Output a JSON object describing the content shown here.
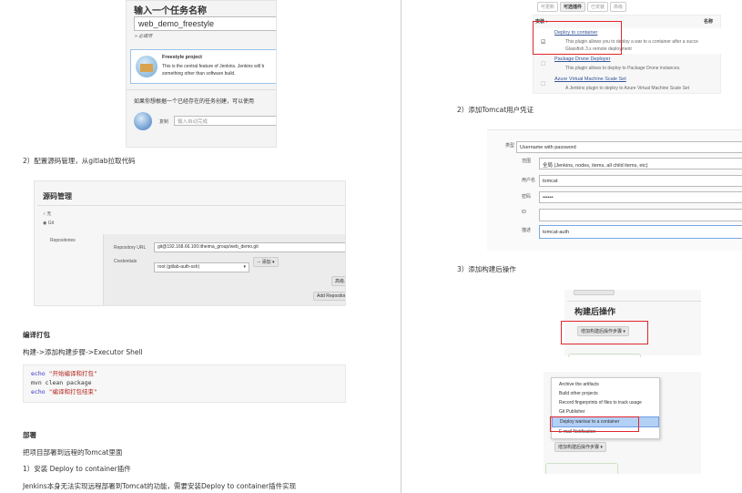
{
  "left": {
    "new_job": {
      "title": "输入一个任务名称",
      "name_value": "web_demo_freestyle",
      "required_hint": "» 必填项",
      "freestyle_title": "Freestyle project",
      "freestyle_desc_1": "This is the central feature of Jenkins. Jenkins will b",
      "freestyle_desc_2": "something other than software build.",
      "copy_hint": "如果你想根据一个已经存在的任务创建，可以使用",
      "copy_label": "复制",
      "copy_placeholder": "输入自动完成"
    },
    "step2_heading": "2）配置源码管理，从gitlab拉取代码",
    "scm": {
      "title": "源码管理",
      "option_none": "无",
      "option_git": "Git",
      "repositories_label": "Repositories",
      "repo_url_label": "Repository URL",
      "repo_url_value": "git@192.168.66.100:itheima_group/web_demo.git",
      "credentials_label": "Credentials",
      "credentials_value": "root (gitlab-auth-ssh)",
      "add_button": "添加",
      "advanced_button": "高级...",
      "add_repo_button": "Add Repository"
    },
    "build_heading": "编译打包",
    "build_path": "构建->添加构建步骤->Executor Shell",
    "code": {
      "l1_kw": "echo",
      "l1_str": "\"开始编译和打包\"",
      "l2": "mvn clean package",
      "l3_kw": "echo",
      "l3_str": "\"编译和打包结束\""
    },
    "deploy_heading": "部署",
    "deploy_desc": "把项目部署到远程的Tomcat里面",
    "step1_heading": "1）安装 Deploy to container插件",
    "step1_desc": "Jenkins本身无法实现远程部署到Tomcat的功能，需要安装Deploy to container插件实现"
  },
  "right": {
    "plugins": {
      "tabs": [
        "可更新",
        "可选插件",
        "已安装",
        "高级"
      ],
      "col_install": "安装 ↓",
      "col_name": "名称",
      "items": [
        {
          "name": "Deploy to container",
          "desc1": "This plugin allows you to deploy a war to a container after a succe",
          "desc2": "Glassfish 3.x remote deployment",
          "checked": true
        },
        {
          "name": "Package Drone Deployer",
          "desc1": "This plugin allows to deploy to Package Drone instances.",
          "checked": false
        },
        {
          "name": "Azure Virtual Machine Scale Set",
          "desc1": "A Jenkins plugin to deploy to Azure Virtual Machine Scale Set",
          "checked": false
        }
      ]
    },
    "step2_heading": "2）添加Tomcat用户凭证",
    "cred": {
      "type_label": "类型",
      "type_value": "Username with password",
      "scope_label": "范围",
      "scope_value": "全局 (Jenkins, nodes, items, all child items, etc)",
      "user_label": "用户名",
      "user_value": "tomcat",
      "pwd_label": "密码",
      "pwd_value": "••••••",
      "id_label": "ID",
      "id_value": "",
      "desc_label": "描述",
      "desc_value": "tomcat-auth"
    },
    "step3_heading": "3）添加构建后操作",
    "post": {
      "title": "构建后操作",
      "add_button": "增加构建后操作步骤 ▾"
    },
    "menu": {
      "items": [
        "Archive the artifacts",
        "Build other projects",
        "Record fingerprints of files to track usage",
        "Git Publisher",
        "Deploy war/ear to a container",
        "E-mail Notification"
      ],
      "add_button": "增加构建后操作步骤 ▾"
    }
  }
}
